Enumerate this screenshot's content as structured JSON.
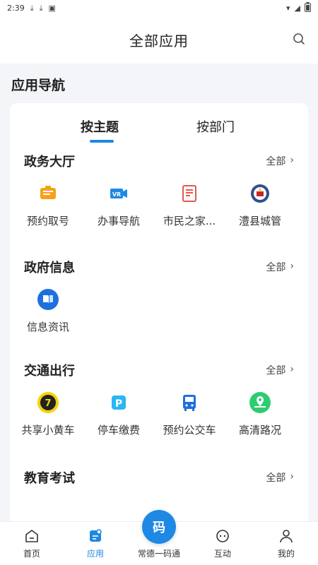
{
  "status_bar": {
    "time": "2:39"
  },
  "header": {
    "title": "全部应用"
  },
  "section": {
    "title": "应用导航"
  },
  "tabs": [
    {
      "label": "按主题",
      "active": true
    },
    {
      "label": "按部门",
      "active": false
    }
  ],
  "groups": [
    {
      "title": "政务大厅",
      "more": "全部",
      "items": [
        {
          "label": "预约取号",
          "icon": "ticket-icon"
        },
        {
          "label": "办事导航",
          "icon": "vr-icon"
        },
        {
          "label": "市民之家...",
          "icon": "book-icon"
        },
        {
          "label": "澧县城管",
          "icon": "emblem-icon"
        }
      ]
    },
    {
      "title": "政府信息",
      "more": "全部",
      "items": [
        {
          "label": "信息资讯",
          "icon": "news-book-icon"
        }
      ]
    },
    {
      "title": "交通出行",
      "more": "全部",
      "items": [
        {
          "label": "共享小黄车",
          "icon": "bike-icon"
        },
        {
          "label": "停车缴费",
          "icon": "parking-icon"
        },
        {
          "label": "预约公交车",
          "icon": "bus-icon"
        },
        {
          "label": "高清路况",
          "icon": "road-map-icon"
        }
      ]
    },
    {
      "title": "教育考试",
      "more": "全部",
      "items": []
    }
  ],
  "bottom_nav": {
    "home": "首页",
    "apps": "应用",
    "center": "常德一码通",
    "center_glyph": "码",
    "interact": "互动",
    "mine": "我的"
  },
  "colors": {
    "accent": "#1e88e5"
  }
}
